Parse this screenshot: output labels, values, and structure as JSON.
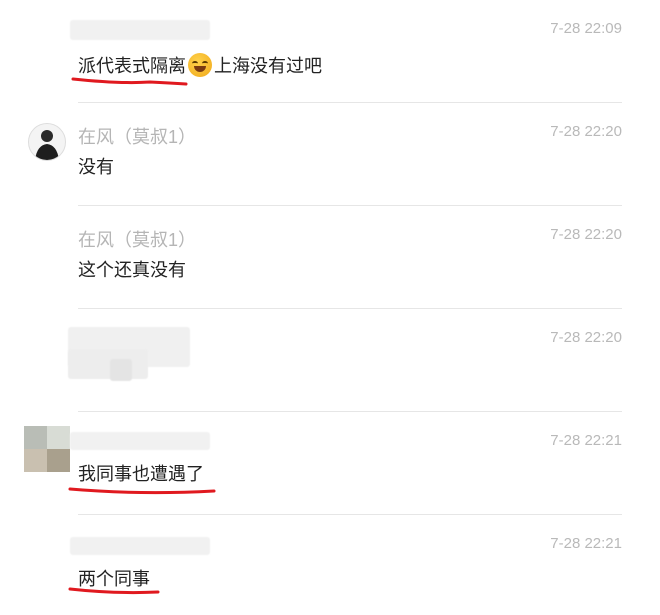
{
  "comments": [
    {
      "name": "",
      "time": "7-28 22:09",
      "text_before": "派代表式隔离",
      "text_after": "上海没有过吧"
    },
    {
      "name": "在风（莫叔1）",
      "time": "7-28 22:20",
      "text": "没有"
    },
    {
      "name": "在风（莫叔1）",
      "time": "7-28 22:20",
      "text": "这个还真没有"
    },
    {
      "name": "",
      "time": "7-28 22:20",
      "text": ""
    },
    {
      "name": "",
      "time": "7-28 22:21",
      "text": "我同事也遭遇了"
    },
    {
      "name": "",
      "time": "7-28 22:21",
      "text": "两个同事"
    }
  ],
  "colors": {
    "underline": "#e0191f",
    "divider": "#e6e6e6",
    "time": "#b9b9b9"
  }
}
